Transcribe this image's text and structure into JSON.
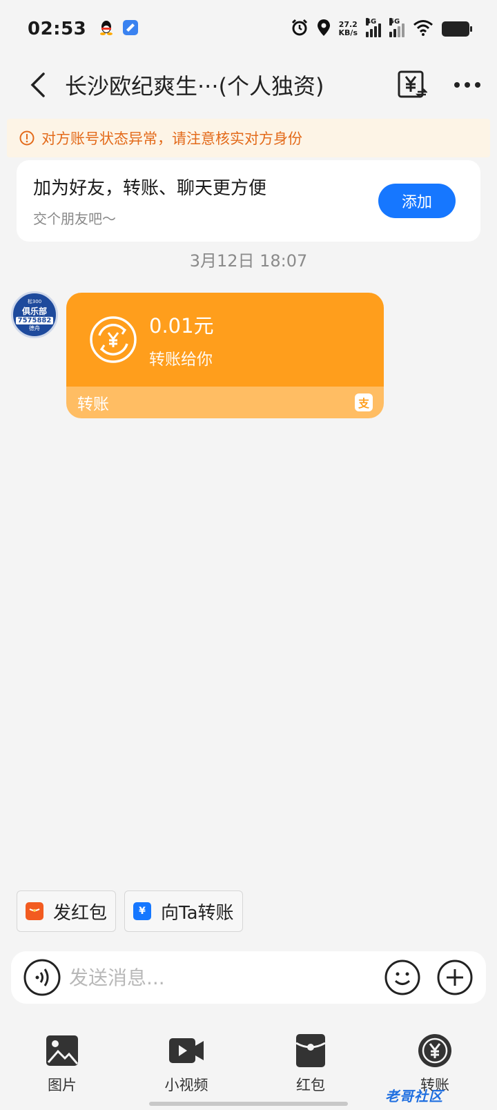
{
  "status_bar": {
    "time": "02:53",
    "net_speed_value": "27.2",
    "net_speed_unit": "KB/s",
    "net_type_1": "4G",
    "net_type_2": "5G"
  },
  "header": {
    "title": "长沙欧纪爽生···(个人独资)"
  },
  "warning": {
    "text": "对方账号状态异常，请注意核实对方身份"
  },
  "add_friend": {
    "title": "加为好友，转账、聊天更方便",
    "subtitle": "交个朋友吧～",
    "button_label": "添加"
  },
  "chat": {
    "timestamp": "3月12日 18:07",
    "avatar_text": {
      "top": "松300",
      "mid": "俱乐部",
      "num": "7575882",
      "bottom": "德舟"
    },
    "transfer_message": {
      "amount": "0.01元",
      "description": "转账给你",
      "footer_label": "转账",
      "badge": "支"
    }
  },
  "quick_actions": [
    {
      "label": "发红包",
      "icon": "red-packet-icon",
      "color": "#f25b20"
    },
    {
      "label": "向Ta转账",
      "icon": "yuan-transfer-icon",
      "color": "#1677ff"
    }
  ],
  "input_bar": {
    "placeholder": "发送消息..."
  },
  "bottom_tools": [
    {
      "label": "图片",
      "icon": "image-icon"
    },
    {
      "label": "小视频",
      "icon": "video-icon"
    },
    {
      "label": "红包",
      "icon": "red-packet-icon"
    },
    {
      "label": "转账",
      "icon": "transfer-icon"
    }
  ],
  "watermark": "老哥社区",
  "colors": {
    "accent": "#1677ff",
    "transfer_orange": "#ff9e1c",
    "warning_text": "#e36a1a"
  }
}
